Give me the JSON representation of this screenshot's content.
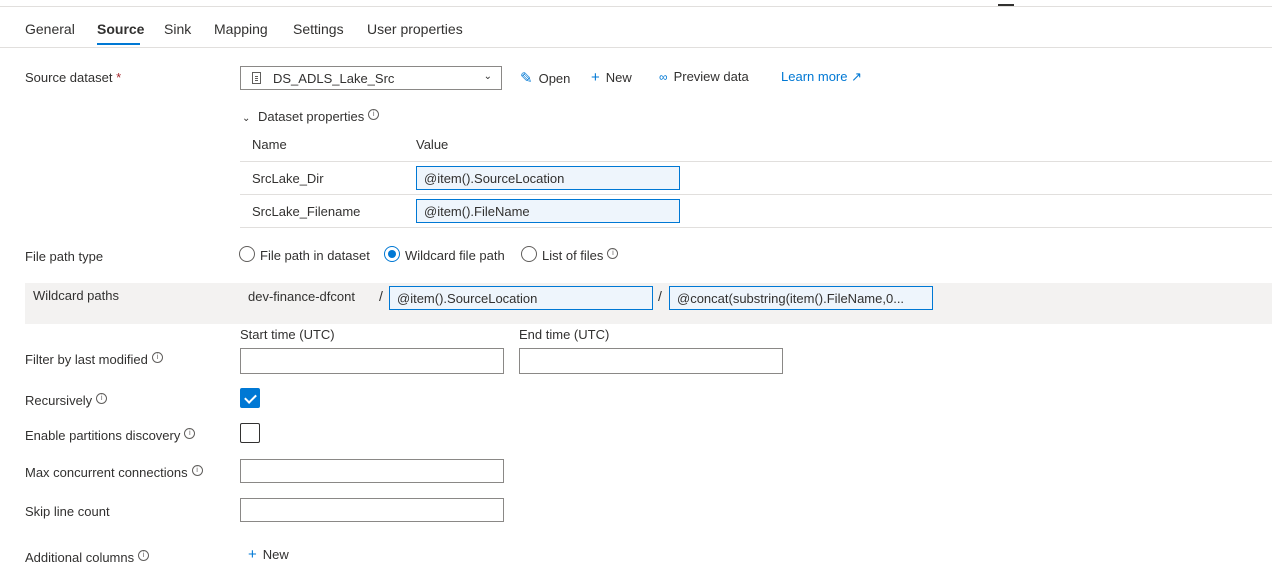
{
  "tabs": [
    "General",
    "Source",
    "Sink",
    "Mapping",
    "Settings",
    "User properties"
  ],
  "active_tab": "Source",
  "source_dataset": {
    "label": "Source dataset",
    "required_mark": "*",
    "value": "DS_ADLS_Lake_Src",
    "actions": {
      "open": "Open",
      "new": "New",
      "preview": "Preview data",
      "learn_more": "Learn more"
    }
  },
  "dataset_properties": {
    "title": "Dataset properties",
    "columns": [
      "Name",
      "Value"
    ],
    "rows": [
      {
        "name": "SrcLake_Dir",
        "value": "@item().SourceLocation"
      },
      {
        "name": "SrcLake_Filename",
        "value": "@item().FileName"
      }
    ]
  },
  "file_path_type": {
    "label": "File path type",
    "options": [
      "File path in dataset",
      "Wildcard file path",
      "List of files"
    ],
    "selected": "Wildcard file path"
  },
  "wildcard_paths": {
    "label": "Wildcard paths",
    "container": "dev-finance-dfcont",
    "separator": "/",
    "folder": "@item().SourceLocation",
    "file": "@concat(substring(item().FileName,0..."
  },
  "filter_modified": {
    "label": "Filter by last modified",
    "start_label": "Start time (UTC)",
    "end_label": "End time (UTC)",
    "start_value": "",
    "end_value": ""
  },
  "recursively": {
    "label": "Recursively",
    "checked": true
  },
  "partitions": {
    "label": "Enable partitions discovery",
    "checked": false
  },
  "max_connections": {
    "label": "Max concurrent connections",
    "value": ""
  },
  "skip_lines": {
    "label": "Skip line count",
    "value": ""
  },
  "additional_columns": {
    "label": "Additional columns",
    "new_label": "New"
  },
  "accent_color": "#0078d4"
}
